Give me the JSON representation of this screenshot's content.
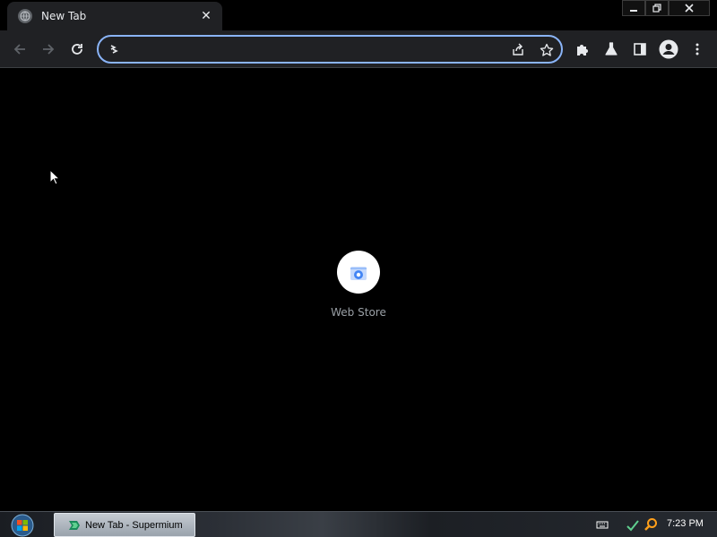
{
  "browser": {
    "tab": {
      "title": "New Tab",
      "favicon": "globe-icon",
      "close_glyph": "✕"
    },
    "window_controls": {
      "minimize": "minimize-icon",
      "restore": "restore-icon",
      "close": "close-icon"
    },
    "toolbar": {
      "back": "arrow-back-icon",
      "forward": "arrow-forward-icon",
      "reload": "reload-icon",
      "omnibox": {
        "value": "",
        "placeholder": ""
      },
      "share": "share-icon",
      "bookmark": "star-icon",
      "extensions": "puzzle-icon",
      "labs": "flask-icon",
      "side_panel": "side-panel-icon",
      "profile": "avatar-icon",
      "menu": "more-vert-icon"
    }
  },
  "new_tab_page": {
    "shortcuts": [
      {
        "label": "Web Store",
        "icon": "web-store-icon"
      }
    ]
  },
  "taskbar": {
    "start": "windows-start-orb",
    "tasks": [
      {
        "label": "New Tab - Supermium",
        "icon": "supermium-icon"
      }
    ],
    "tray": [
      "keyboard-icon",
      "network-icon",
      "search-icon"
    ],
    "clock": "7:23 PM"
  },
  "colors": {
    "accent": "#8ab4f8",
    "toolbar_bg": "#202124",
    "page_bg": "#000000",
    "text": "#e8eaed",
    "muted_text": "#9aa0a6"
  }
}
